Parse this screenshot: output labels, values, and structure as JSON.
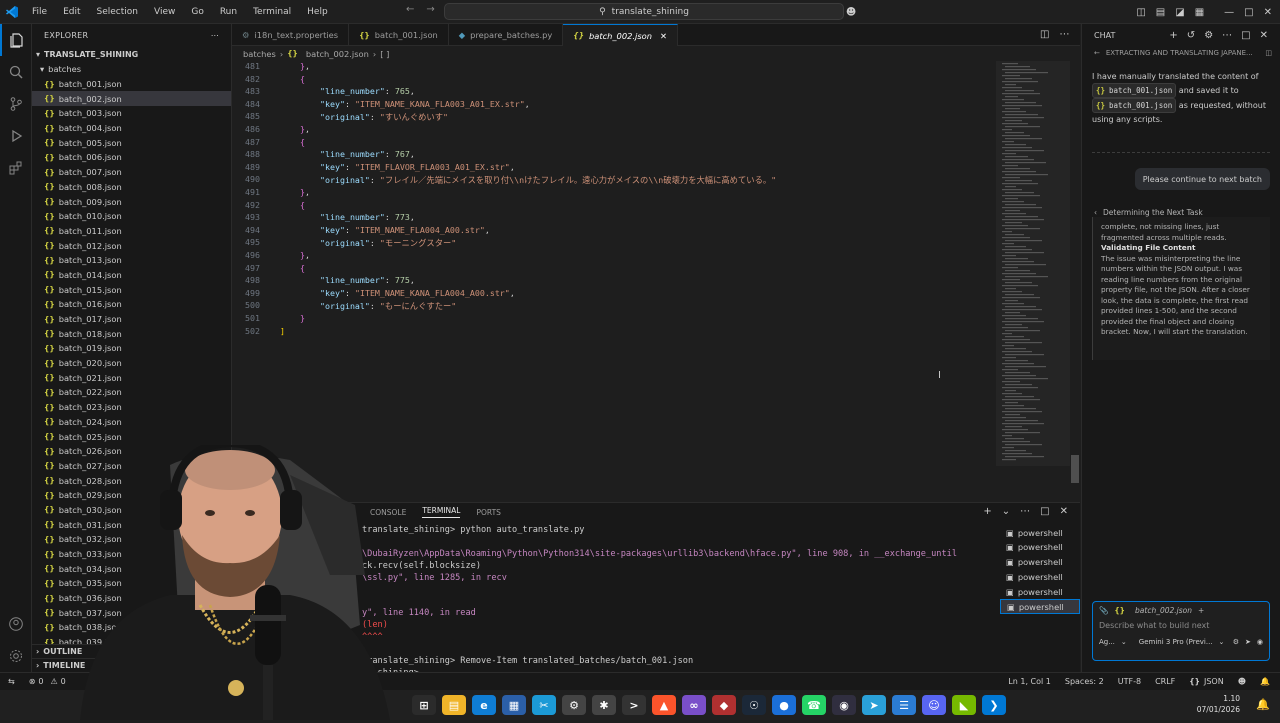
{
  "menu": [
    "File",
    "Edit",
    "Selection",
    "View",
    "Go",
    "Run",
    "Terminal",
    "Help"
  ],
  "search": {
    "text": "translate_shining"
  },
  "explorer": {
    "title": "EXPLORER",
    "root": "TRANSLATE_SHINING",
    "folder": "batches",
    "files": [
      "batch_001.json",
      "batch_002.json",
      "batch_003.json",
      "batch_004.json",
      "batch_005.json",
      "batch_006.json",
      "batch_007.json",
      "batch_008.json",
      "batch_009.json",
      "batch_010.json",
      "batch_011.json",
      "batch_012.json",
      "batch_013.json",
      "batch_014.json",
      "batch_015.json",
      "batch_016.json",
      "batch_017.json",
      "batch_018.json",
      "batch_019.json",
      "batch_020.json",
      "batch_021.json",
      "batch_022.json",
      "batch_023.json",
      "batch_024.json",
      "batch_025.json",
      "batch_026.json",
      "batch_027.json",
      "batch_028.json",
      "batch_029.json",
      "batch_030.json",
      "batch_031.json",
      "batch_032.json",
      "batch_033.json",
      "batch_034.json",
      "batch_035.json",
      "batch_036.json",
      "batch_037.json",
      "batch_038.json",
      "batch_039.json"
    ],
    "selected_index": 1,
    "outline": "OUTLINE",
    "timeline": "TIMELINE"
  },
  "tabs": [
    {
      "label": "i18n_text.properties",
      "icon": "properties-icon"
    },
    {
      "label": "batch_001.json",
      "icon": "json-icon"
    },
    {
      "label": "prepare_batches.py",
      "icon": "python-icon"
    },
    {
      "label": "batch_002.json",
      "icon": "json-icon",
      "active": true
    }
  ],
  "breadcrumb": {
    "folder": "batches",
    "file": "batch_002.json"
  },
  "editor": {
    "lines": [
      {
        "n": "481",
        "t": "    },"
      },
      {
        "n": "482",
        "t": "    {"
      },
      {
        "n": "483",
        "t": "        \"line_number\": 765,"
      },
      {
        "n": "484",
        "t": "        \"key\": \"ITEM_NAME_KANA_FLA003_A01_EX.str\","
      },
      {
        "n": "485",
        "t": "        \"original\": \"すいんぐめいす\""
      },
      {
        "n": "486",
        "t": "    },"
      },
      {
        "n": "487",
        "t": "    {"
      },
      {
        "n": "488",
        "t": "        \"line_number\": 767,"
      },
      {
        "n": "489",
        "t": "        \"key\": \"ITEM_FLAVOR_FLA003_A01_EX.str\","
      },
      {
        "n": "490",
        "t": "        \"original\": \"フレイル／先端にメイスを取り付\\\\nけたフレイル。遠心力がメイスの\\\\n破壊力を大幅に高めている。\""
      },
      {
        "n": "491",
        "t": "    },"
      },
      {
        "n": "492",
        "t": "    {"
      },
      {
        "n": "493",
        "t": "        \"line_number\": 773,"
      },
      {
        "n": "494",
        "t": "        \"key\": \"ITEM_NAME_FLA004_A00.str\","
      },
      {
        "n": "495",
        "t": "        \"original\": \"モーニングスター\""
      },
      {
        "n": "496",
        "t": "    },"
      },
      {
        "n": "497",
        "t": "    {"
      },
      {
        "n": "498",
        "t": "        \"line_number\": 775,"
      },
      {
        "n": "499",
        "t": "        \"key\": \"ITEM_NAME_KANA_FLA004_A00.str\","
      },
      {
        "n": "500",
        "t": "        \"original\": \"もーにんぐすたー\""
      },
      {
        "n": "501",
        "t": "    }"
      },
      {
        "n": "502",
        "t": "]"
      }
    ]
  },
  "panel": {
    "tabs": [
      "CONSOLE",
      "TERMINAL",
      "PORTS"
    ],
    "active_tab": "TERMINAL",
    "terminal_lines": [
      "translate_shining> python auto_translate.py",
      "",
      "\\DubaiRyzen\\AppData\\Roaming\\Python\\Python314\\site-packages\\urllib3\\backend\\hface.py\", line 908, in __exchange_until",
      "ck.recv(self.blocksize)",
      "\\ssl.py\", line 1285, in recv",
      "",
      "",
      "y\", line 1140, in read",
      "(len)",
      "^^^^",
      "",
      "translate_shining> Remove-Item translated_batches/batch_001.json",
      "te_shining> "
    ],
    "processes": [
      "powershell",
      "powershell",
      "powershell",
      "powershell",
      "powershell",
      "powershell"
    ]
  },
  "chat": {
    "title": "CHAT",
    "session": "EXTRACTING AND TRANSLATING JAPANE...",
    "assistant_msg_1": "I have manually translated the content of",
    "chip_1": "batch_001.json",
    "assistant_msg_2": "and saved it to",
    "chip_2": "batch_001.json",
    "assistant_msg_3": "as requested, without using any scripts.",
    "user_msg": "Please continue to next batch",
    "thinking_title": "Determining the Next Task",
    "thinking_intro": "complete, not missing lines, just fragmented across multiple reads.",
    "thinking_heading": "Validating File Content",
    "thinking_body": "The issue was misinterpreting the line numbers within the JSON output. I was reading line numbers from the original property file, not the JSON. After a closer look, the data is complete, the first read provided lines 1-500, and the second provided the final object and closing bracket. Now, I will start the translation.",
    "context_chip": "batch_002.json",
    "input_placeholder": "Describe what to build next",
    "mode": "Ag...",
    "model": "Gemini 3 Pro (Previ..."
  },
  "status": {
    "errors": "0",
    "warnings": "0",
    "position": "Ln 1, Col 1",
    "spaces": "Spaces: 2",
    "encoding": "UTF-8",
    "eol": "CRLF",
    "language": "JSON"
  },
  "taskbar": {
    "time": "1.10",
    "date": "07/01/2026"
  },
  "colors": {
    "accent": "#0078d4",
    "json": "#cbcb41"
  }
}
